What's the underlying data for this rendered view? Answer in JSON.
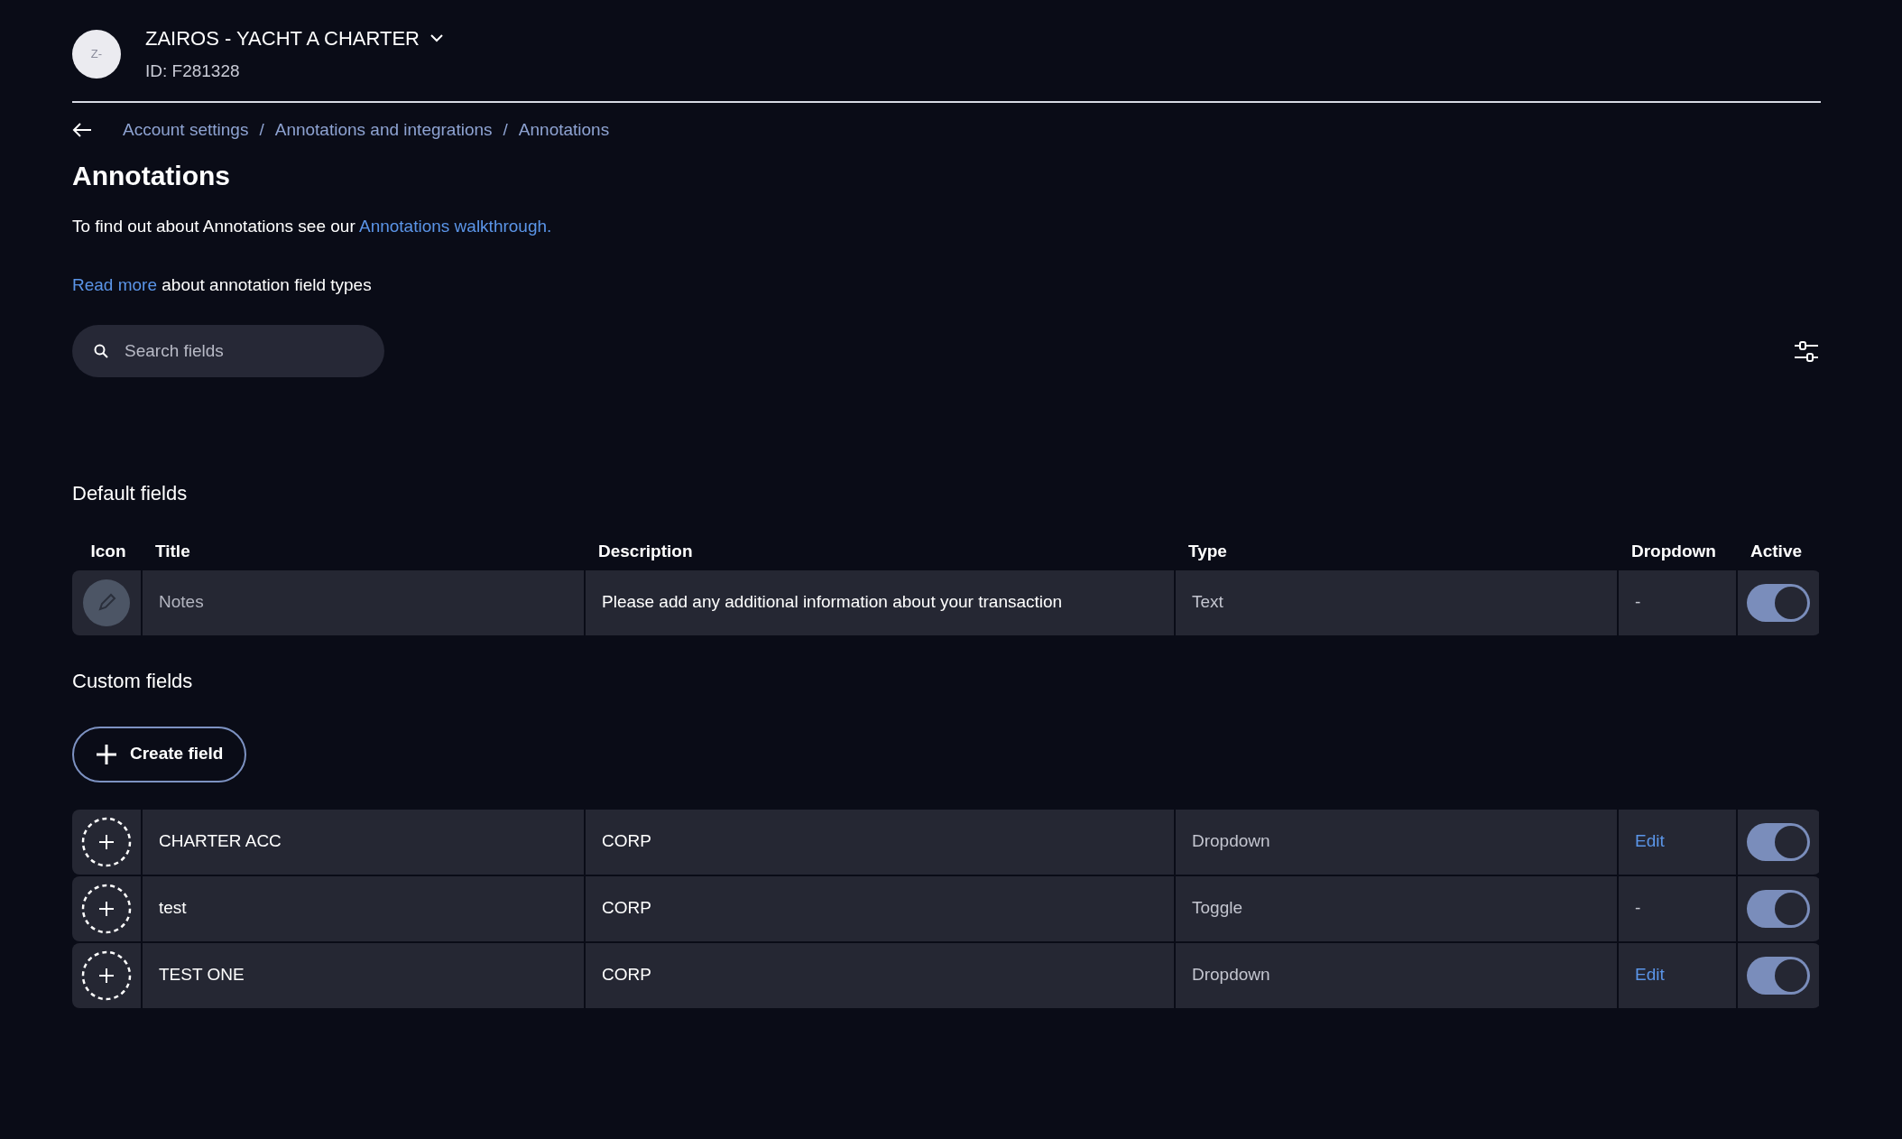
{
  "account": {
    "avatar": "Z-",
    "name": "ZAIROS - YACHT A CHARTER",
    "id": "ID: F281328"
  },
  "breadcrumb": [
    "Account settings",
    "Annotations and integrations",
    "Annotations"
  ],
  "breadcrumb_separator": "/",
  "title": "Annotations",
  "intro": {
    "text": "To find out about Annotations see our ",
    "link": "Annotations walkthrough."
  },
  "read_more": {
    "link": "Read more",
    "text": " about annotation field types"
  },
  "search": {
    "placeholder": "Search fields"
  },
  "columns": [
    "Icon",
    "Title",
    "Description",
    "Type",
    "Dropdown",
    "Active"
  ],
  "default_fields": {
    "heading": "Default fields",
    "rows": [
      {
        "title": "Notes",
        "description": "Please add any additional information about your transaction",
        "type": "Text",
        "dropdown": {
          "kind": "none",
          "text": "-"
        },
        "active": true
      }
    ]
  },
  "custom_fields": {
    "heading": "Custom fields",
    "create_button": "Create field",
    "rows": [
      {
        "title": "CHARTER ACC",
        "description": "CORP",
        "type": "Dropdown",
        "dropdown": {
          "kind": "link",
          "text": "Edit"
        },
        "active": true
      },
      {
        "title": "test",
        "description": "CORP",
        "type": "Toggle",
        "dropdown": {
          "kind": "none",
          "text": "-"
        },
        "active": true
      },
      {
        "title": "TEST ONE",
        "description": "CORP",
        "type": "Dropdown",
        "dropdown": {
          "kind": "link",
          "text": "Edit"
        },
        "active": true
      }
    ]
  }
}
